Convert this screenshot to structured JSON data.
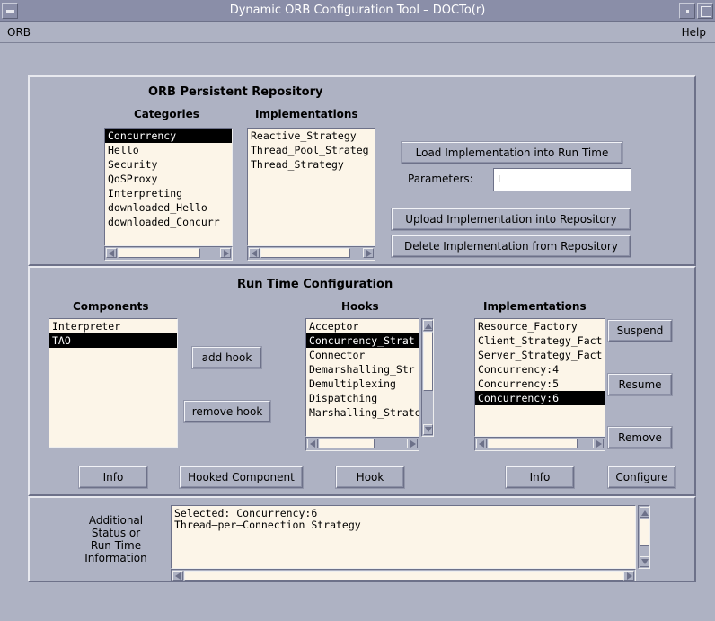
{
  "window": {
    "title": "Dynamic ORB Configuration Tool – DOCTo(r)"
  },
  "menubar": {
    "orb": "ORB",
    "help": "Help"
  },
  "repository": {
    "heading": "ORB Persistent Repository",
    "categories_label": "Categories",
    "implementations_label": "Implementations",
    "categories": [
      "Concurrency",
      "Hello",
      "Security",
      "QoSProxy",
      "Interpreting",
      "downloaded_Hello",
      "downloaded_Concurr"
    ],
    "categories_selected": "Concurrency",
    "implementations": [
      "Reactive_Strategy",
      "Thread_Pool_Strateg",
      "Thread_Strategy"
    ],
    "load_button": "Load Implementation into Run Time",
    "parameters_label": "Parameters:",
    "parameters_value": "",
    "upload_button": "Upload Implementation into Repository",
    "delete_button": "Delete Implementation from Repository"
  },
  "runtime": {
    "heading": "Run Time Configuration",
    "components_label": "Components",
    "hooks_label": "Hooks",
    "implementations_label": "Implementations",
    "components": [
      "Interpreter",
      "TAO"
    ],
    "components_selected": "TAO",
    "hooks": [
      "Acceptor",
      "Concurrency_Strat",
      "Connector",
      "Demarshalling_Str",
      "Demultiplexing",
      "Dispatching",
      "Marshalling_Strate"
    ],
    "hooks_selected": "Concurrency_Strat",
    "implementations": [
      "Resource_Factory",
      "Client_Strategy_Fact",
      "Server_Strategy_Fact",
      "Concurrency:4",
      "Concurrency:5",
      "Concurrency:6"
    ],
    "implementations_selected": "Concurrency:6",
    "add_hook_button": "add hook",
    "remove_hook_button": "remove hook",
    "suspend_button": "Suspend",
    "resume_button": "Resume",
    "remove_button": "Remove",
    "info_button_left": "Info",
    "hooked_component_button": "Hooked Component",
    "hook_button": "Hook",
    "info_button_right": "Info",
    "configure_button": "Configure"
  },
  "status": {
    "label_lines": [
      "Additional",
      "Status or",
      "Run Time",
      "Information"
    ],
    "text_lines": [
      "Selected: Concurrency:6",
      "Thread–per–Connection Strategy"
    ]
  },
  "colors": {
    "background": "#aeb2c3",
    "list_bg": "#fcf5e8",
    "titlebar": "#8a8ea8",
    "selection": "#000000"
  }
}
